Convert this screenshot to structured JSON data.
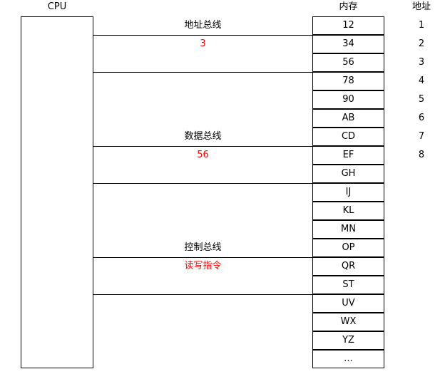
{
  "cpu": {
    "label": "CPU"
  },
  "memory": {
    "title": "内存",
    "cells": [
      "12",
      "34",
      "56",
      "78",
      "90",
      "AB",
      "CD",
      "EF",
      "GH",
      "IJ",
      "KL",
      "MN",
      "OP",
      "QR",
      "ST",
      "UV",
      "WX",
      "YZ",
      "..."
    ]
  },
  "address": {
    "title": "地址",
    "values": [
      "1",
      "2",
      "3",
      "4",
      "5",
      "6",
      "7",
      "8"
    ]
  },
  "buses": {
    "address": {
      "name": "地址总线",
      "value": "3"
    },
    "data": {
      "name": "数据总线",
      "value": "56"
    },
    "control": {
      "name": "控制总线",
      "value": "读写指令"
    }
  },
  "colors": {
    "highlight": "#ff0000",
    "line": "#000000"
  }
}
